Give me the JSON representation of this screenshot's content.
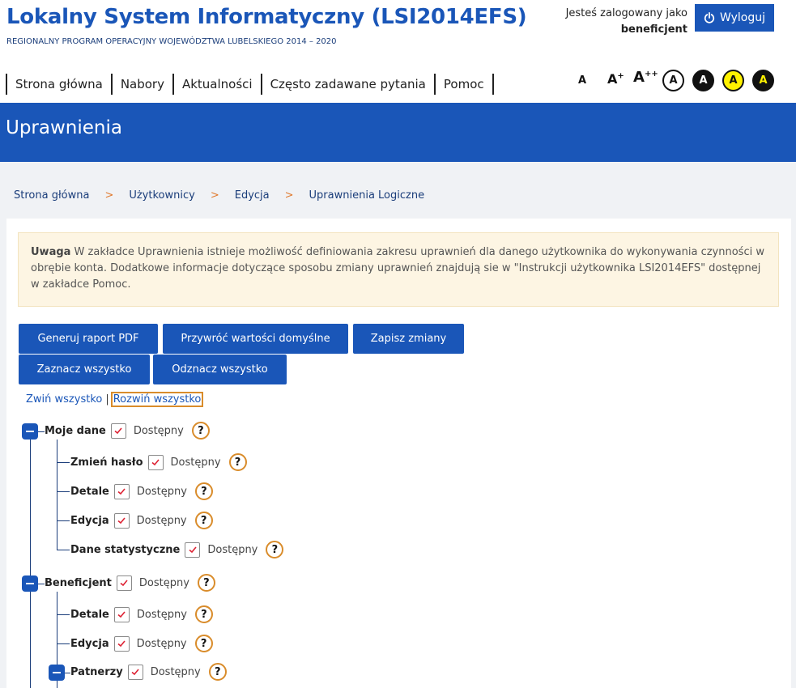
{
  "header": {
    "title": "Lokalny System Informatyczny (LSI2014EFS)",
    "subtitle": "REGIONALNY PROGRAM OPERACYJNY WOJEWÓDZTWA LUBELSKIEGO 2014 – 2020",
    "logged_as": "Jesteś zalogowany jako",
    "user": "beneficjent",
    "logout": "Wyloguj"
  },
  "nav": [
    "Strona główna",
    "Nabory",
    "Aktualności",
    "Często zadawane pytania",
    "Pomoc"
  ],
  "accessibility": {
    "font_small": "A",
    "font_medium": "A+",
    "font_large": "A++",
    "contrast": [
      "A",
      "A",
      "A",
      "A"
    ]
  },
  "page_title": "Uprawnienia",
  "breadcrumb": [
    "Strona główna",
    "Użytkownicy",
    "Edycja",
    "Uprawnienia Logiczne"
  ],
  "breadcrumb_sep": ">",
  "alert": {
    "strong": "Uwaga",
    "text": " W zakładce Uprawnienia istnieje możliwość definiowania zakresu uprawnień dla danego użytkownika do wykonywania czynności w obrębie konta. Dodatkowe informacje dotyczące sposobu zmiany uprawnień znajdują sie w \"Instrukcji użytkownika LSI2014EFS\" dostępnej w zakładce Pomoc."
  },
  "buttons": {
    "pdf": "Generuj raport PDF",
    "restore": "Przywróć wartości domyślne",
    "save": "Zapisz zmiany",
    "select_all": "Zaznacz wszystko",
    "deselect_all": "Odznacz wszystko"
  },
  "tree_toggle": {
    "collapse": "Zwiń wszystko",
    "sep": "|",
    "expand": "Rozwiń wszystko"
  },
  "available_label": "Dostępny",
  "help_label": "?",
  "tree": [
    {
      "label": "Moje dane",
      "checked": true
    },
    {
      "label": "Zmień hasło",
      "checked": true
    },
    {
      "label": "Detale",
      "checked": true
    },
    {
      "label": "Edycja",
      "checked": true
    },
    {
      "label": "Dane statystyczne",
      "checked": true
    },
    {
      "label": "Beneficjent",
      "checked": true
    },
    {
      "label": "Detale",
      "checked": true
    },
    {
      "label": "Edycja",
      "checked": true
    },
    {
      "label": "Patnerzy",
      "checked": true
    }
  ],
  "colors": {
    "primary": "#1a56b8",
    "accent": "#d98c2b",
    "contrast_yellow": "#fff200"
  }
}
